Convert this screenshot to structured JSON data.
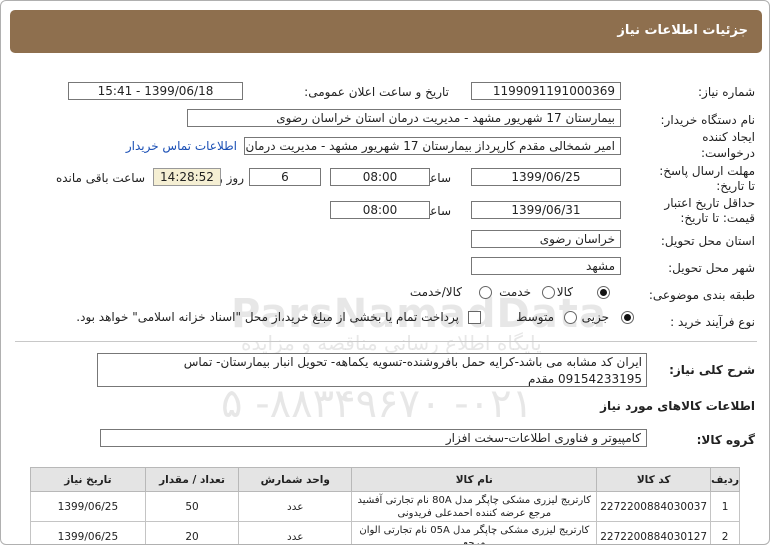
{
  "header": {
    "title": "جزئیات اطلاعات نیاز"
  },
  "fields": {
    "need_number_label": "شماره نیاز:",
    "need_number": "1199091191000369",
    "announce_label": "تاریخ و ساعت اعلان عمومی:",
    "announce_value": "1399/06/18 - 15:41",
    "buyer_label": "نام دستگاه خریدار:",
    "buyer_value": "بیمارستان 17 شهریور مشهد - مدیریت درمان استان خراسان رضوی",
    "creator_label_1": "ایجاد کننده",
    "creator_label_2": "درخواست:",
    "creator_value": "امیر  شمخالی مقدم کارپرداز بیمارستان 17 شهریور مشهد - مدیریت درمان استان",
    "contact_link": "اطلاعات تماس خریدار",
    "deadline_label_1": "مهلت ارسال پاسخ:",
    "deadline_label_2": "تا تاریخ:",
    "deadline_date": "1399/06/25",
    "time_label": "ساعت",
    "deadline_time": "08:00",
    "days_count": "6",
    "days_label": "روز و",
    "remaining_time": "14:28:52",
    "remaining_label": "ساعت باقی مانده",
    "validity_label_1": "حداقل تاریخ اعتبار",
    "validity_label_2": "قیمت: تا تاریخ:",
    "validity_date": "1399/06/31",
    "validity_time": "08:00",
    "province_label": "استان محل تحویل:",
    "province_value": "خراسان رضوی",
    "city_label": "شهر محل تحویل:",
    "city_value": "مشهد",
    "category_label": "طبقه بندی موضوعی:",
    "category_options": [
      "کالا",
      "خدمت",
      "کالا/خدمت"
    ],
    "category_selected": "کالا",
    "process_label": "نوع فرآیند خرید :",
    "process_options": [
      "جزیی",
      "متوسط"
    ],
    "process_selected": "جزیی",
    "payment_note": "پرداخت تمام یا بخشی از مبلغ خرید،از محل \"اسناد خزانه اسلامی\" خواهد بود."
  },
  "description": {
    "label": "شرح کلی نیاز:",
    "text": "ایران کد مشابه می باشد-کرایه حمل بافروشنده-تسویه یکماهه- تحویل انبار بیمارستان- تماس 09154233195 مقدم"
  },
  "goods": {
    "section_title": "اطلاعات کالاهای مورد نیاز",
    "group_label": "گروه کالا:",
    "group_value": "کامپیوتر و فناوری اطلاعات-سخت افزار"
  },
  "watermark": {
    "line1": "ParsNamadData",
    "line2": "پایگاه اطلاع رسانی مناقصه و مزایده",
    "line3": "۰۲۱- ۸۸۳۴۹۶۷۰- ۵"
  },
  "table": {
    "headers": [
      "ردیف",
      "کد کالا",
      "نام کالا",
      "واحد شمارش",
      "تعداد / مقدار",
      "تاریخ نیاز"
    ],
    "rows": [
      [
        "1",
        "2272200884030037",
        "کارتریج لیزری مشکی چاپگر مدل 80A نام تجارتی آفشید مرجع عرضه کننده احمدعلی فریدونی",
        "عدد",
        "50",
        "1399/06/25"
      ],
      [
        "2",
        "2272200884030127",
        "کارتریج لیزری مشکی چاپگر مدل 05A نام تجارتی الوان مرجع",
        "عدد",
        "20",
        "1399/06/25"
      ]
    ]
  }
}
